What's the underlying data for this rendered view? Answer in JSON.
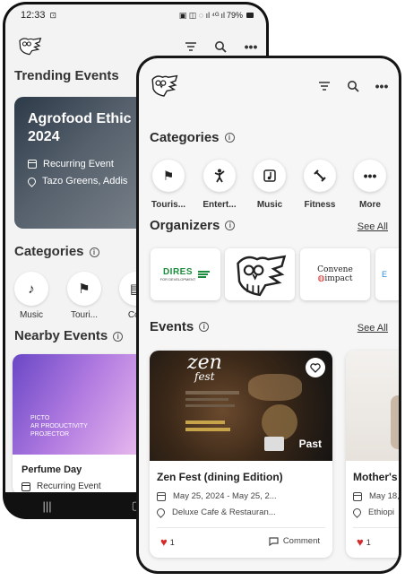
{
  "back_phone": {
    "status": {
      "time": "12:33",
      "signal": "⁴ᴳ",
      "battery": "79%"
    },
    "trending": {
      "heading": "Trending Events",
      "card": {
        "title": "Agrofood Ethic 2024",
        "recurring": "Recurring Event",
        "location": "Tazo Greens, Addis"
      }
    },
    "categories": {
      "heading": "Categories",
      "items": [
        {
          "label": "Music",
          "icon": "music-note-icon"
        },
        {
          "label": "Touri...",
          "icon": "flag-icon"
        },
        {
          "label": "Con",
          "icon": "monitor-icon"
        }
      ]
    },
    "nearby": {
      "heading": "Nearby Events",
      "card": {
        "banner_line1": "PICTO",
        "banner_line2": "AR PRODUCTIVITY",
        "banner_line3": "PROJECTOR",
        "title": "Perfume Day",
        "recurring": "Recurring Event"
      }
    }
  },
  "front_phone": {
    "categories": {
      "heading": "Categories",
      "items": [
        {
          "label": "Touris...",
          "icon": "flag-icon"
        },
        {
          "label": "Entert...",
          "icon": "person-dance-icon"
        },
        {
          "label": "Music",
          "icon": "music-note-icon"
        },
        {
          "label": "Fitness",
          "icon": "dumbbell-icon"
        },
        {
          "label": "More",
          "icon": "more-dots-icon"
        }
      ]
    },
    "organizers": {
      "heading": "Organizers",
      "see_all": "See All",
      "logos": [
        {
          "name": "DIRES",
          "sub": "FOR DEVELOPMENT"
        },
        {
          "name": "owl-logo"
        },
        {
          "name": "Convene",
          "sub": "impact"
        }
      ]
    },
    "events": {
      "heading": "Events",
      "see_all": "See All",
      "cards": [
        {
          "title": "Zen Fest (dining Edition)",
          "date": "May 25, 2024 - May 25, 2...",
          "location": "Deluxe Cafe & Restauran...",
          "likes": "1",
          "comment": "Comment",
          "badge": "Past",
          "poster_title": "zen",
          "poster_sub": "fest"
        },
        {
          "title": "Mother's",
          "date": "May 18,",
          "location": "Ethiopi",
          "likes": "1"
        }
      ]
    }
  },
  "colors": {
    "accent_red": "#d32b2b",
    "card_bg": "#ffffff",
    "screen_bg": "#f6f6f6"
  }
}
